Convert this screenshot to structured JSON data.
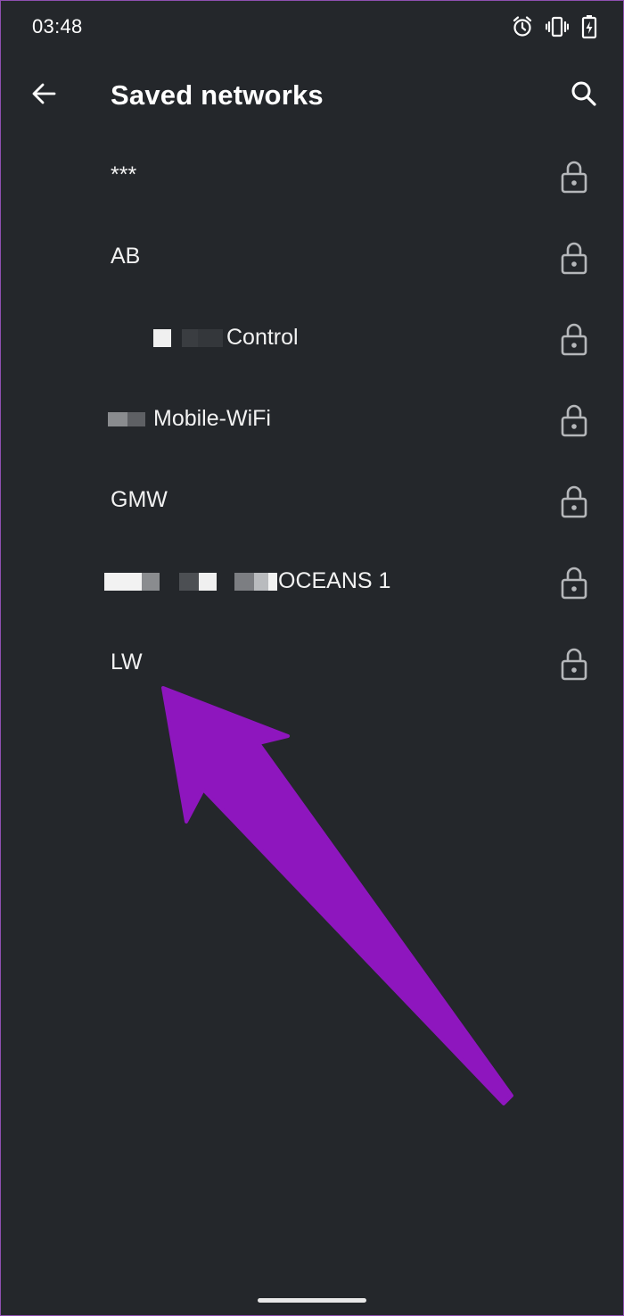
{
  "status_bar": {
    "time": "03:48",
    "icons": [
      "alarm-icon",
      "vibrate-icon",
      "battery-charging-icon"
    ]
  },
  "app_bar": {
    "title": "Saved networks",
    "back_icon": "back-arrow-icon",
    "search_icon": "search-icon"
  },
  "networks": [
    {
      "name": "***",
      "secured": true
    },
    {
      "name": "AB",
      "secured": true
    },
    {
      "name": "Control",
      "secured": true
    },
    {
      "name": "Mobile-WiFi",
      "secured": true
    },
    {
      "name": "GMW",
      "secured": true
    },
    {
      "name": "OCEANS 1",
      "secured": true
    },
    {
      "name": "LW",
      "secured": true
    }
  ],
  "colors": {
    "background": "#24272b",
    "text": "#ffffff",
    "icon": "#b5b7ba",
    "annotation_arrow": "#8e16be"
  }
}
